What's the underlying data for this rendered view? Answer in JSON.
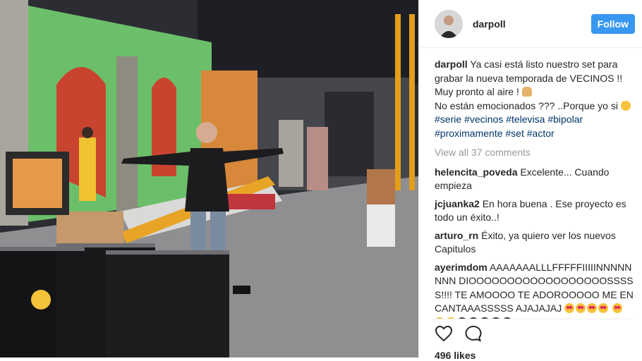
{
  "post": {
    "username": "darpoll",
    "follow_label": "Follow",
    "caption": {
      "username": "darpoll",
      "text_line1": "Ya casi está listo nuestro set para grabar la nueva temporada de VECINOS !! Muy pronto al aire !",
      "text_line2": "No están emocionados ??? ..Porque yo si",
      "hashtags": [
        "#serie",
        "#vecinos",
        "#televisa",
        "#bipolar",
        "#proximamente",
        "#set",
        "#actor"
      ]
    },
    "view_all_label": "View all 37 comments",
    "comments": [
      {
        "user": "helencita_poveda",
        "text": "Excelente... Cuando empieza"
      },
      {
        "user": "jcjuanka2",
        "text": "En hora buena . Ese proyecto es todo un éxito..!"
      },
      {
        "user": "arturo_rn",
        "text": "Éxito, ya quiero ver los nuevos Capitulos"
      },
      {
        "user": "ayerimdom",
        "text": "AAAAAAALLLFFFFFIIIIINNNNNNNN DIOOOOOOOOOOOOOOOOOOSSSSS!!!! TE AMOOOO TE ADOROOOOO ME ENCANTAAASSSSS AJAJAJAJ"
      }
    ],
    "likes": "496 likes"
  },
  "icons": {
    "avatar": "profile-avatar",
    "like": "heart-icon",
    "comment": "comment-bubble-icon"
  },
  "colors": {
    "follow_bg": "#3897f0",
    "hashtag": "#003569",
    "muted": "#999999",
    "text": "#262626"
  }
}
